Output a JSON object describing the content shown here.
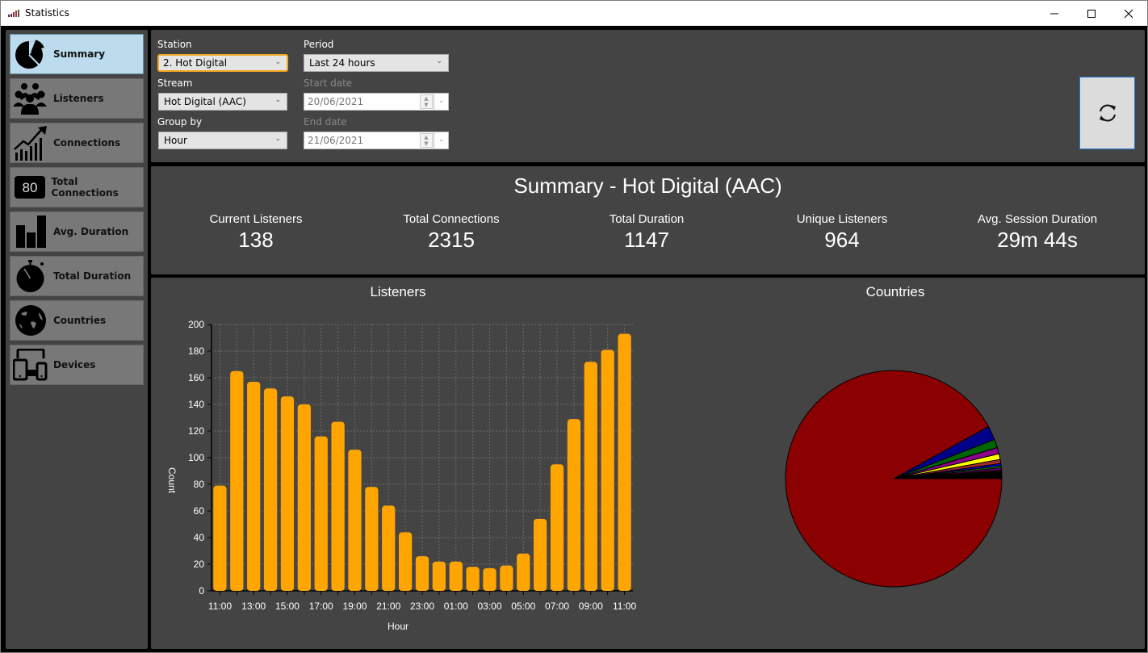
{
  "window": {
    "title": "Statistics",
    "controls": [
      "minimize",
      "maximize",
      "close"
    ]
  },
  "sidebar": {
    "items": [
      {
        "label": "Summary",
        "icon": "pie-chart-icon",
        "active": true
      },
      {
        "label": "Listeners",
        "icon": "people-icon",
        "active": false
      },
      {
        "label": "Connections",
        "icon": "trend-chart-icon",
        "active": false
      },
      {
        "label": "Total Connections",
        "icon": "counter-icon",
        "icon_text": "80",
        "active": false
      },
      {
        "label": "Avg. Duration",
        "icon": "bar-chart-icon",
        "active": false
      },
      {
        "label": "Total Duration",
        "icon": "stopwatch-icon",
        "active": false
      },
      {
        "label": "Countries",
        "icon": "globe-icon",
        "active": false
      },
      {
        "label": "Devices",
        "icon": "devices-icon",
        "active": false
      }
    ]
  },
  "filters": {
    "station_label": "Station",
    "station_value": "2. Hot Digital",
    "stream_label": "Stream",
    "stream_value": "Hot Digital (AAC)",
    "groupby_label": "Group by",
    "groupby_value": "Hour",
    "period_label": "Period",
    "period_value": "Last 24 hours",
    "start_label": "Start date",
    "start_value": "20/06/2021",
    "end_label": "End date",
    "end_value": "21/06/2021",
    "refresh_icon": "refresh-icon"
  },
  "summary": {
    "title": "Summary - Hot Digital (AAC)",
    "stats": [
      {
        "label": "Current Listeners",
        "value": "138"
      },
      {
        "label": "Total Connections",
        "value": "2315"
      },
      {
        "label": "Total Duration",
        "value": "1147"
      },
      {
        "label": "Unique Listeners",
        "value": "964"
      },
      {
        "label": "Avg. Session Duration",
        "value": "29m 44s"
      }
    ]
  },
  "chart_data": [
    {
      "type": "bar",
      "title": "Listeners",
      "xlabel": "Hour",
      "ylabel": "Count",
      "ylim": [
        0,
        200
      ],
      "yticks": [
        0,
        20,
        40,
        60,
        80,
        100,
        120,
        140,
        160,
        180,
        200
      ],
      "grid": true,
      "bar_color": "#FFA500",
      "categories": [
        "11:00",
        "12:00",
        "13:00",
        "14:00",
        "15:00",
        "16:00",
        "17:00",
        "18:00",
        "19:00",
        "20:00",
        "21:00",
        "22:00",
        "23:00",
        "00:00",
        "01:00",
        "02:00",
        "03:00",
        "04:00",
        "05:00",
        "06:00",
        "07:00",
        "08:00",
        "09:00",
        "10:00",
        "11:00"
      ],
      "xtick_labels": [
        "11:00",
        "13:00",
        "15:00",
        "17:00",
        "19:00",
        "21:00",
        "23:00",
        "01:00",
        "03:00",
        "05:00",
        "07:00",
        "09:00",
        "11:00"
      ],
      "values": [
        79,
        165,
        157,
        152,
        146,
        140,
        116,
        127,
        106,
        78,
        64,
        44,
        26,
        22,
        22,
        18,
        17,
        19,
        28,
        54,
        95,
        129,
        172,
        181,
        193
      ]
    },
    {
      "type": "pie",
      "title": "Countries",
      "legend": "none",
      "slices": [
        {
          "color": "#8B0000",
          "percent": 92.0
        },
        {
          "color": "#00008B",
          "percent": 2.1
        },
        {
          "color": "#006400",
          "percent": 1.25
        },
        {
          "color": "#8B008B",
          "percent": 0.95
        },
        {
          "color": "#FFFF00",
          "percent": 0.85
        },
        {
          "color": "#A52A2A",
          "percent": 0.6
        },
        {
          "color": "#0000CD",
          "percent": 0.35
        },
        {
          "color": "#008000",
          "percent": 0.3
        },
        {
          "color": "#800080",
          "percent": 0.3
        },
        {
          "color": "#5A1E1E",
          "percent": 0.2
        },
        {
          "color": "#000000",
          "percent": 1.1
        }
      ]
    }
  ]
}
